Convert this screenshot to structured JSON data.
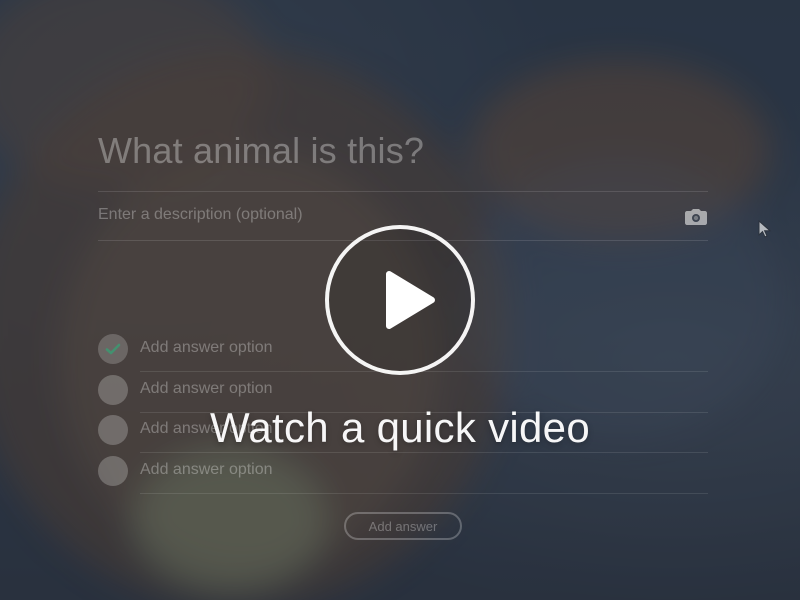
{
  "question": {
    "title": "What animal is this?",
    "description_placeholder": "Enter a description (optional)"
  },
  "icons": {
    "camera": "camera-icon",
    "check": "check-icon",
    "play": "play-icon",
    "cursor": "mouse-pointer-icon"
  },
  "answers": [
    {
      "label": "Add answer option",
      "checked": true
    },
    {
      "label": "Add answer option",
      "checked": false
    },
    {
      "label": "Add answer option",
      "checked": false
    },
    {
      "label": "Add answer option",
      "checked": false
    }
  ],
  "buttons": {
    "add_answer": "Add answer"
  },
  "video_overlay": {
    "text": "Watch a quick video"
  },
  "colors": {
    "check_accent": "#2ea876",
    "overlay_text": "#ffffff"
  }
}
